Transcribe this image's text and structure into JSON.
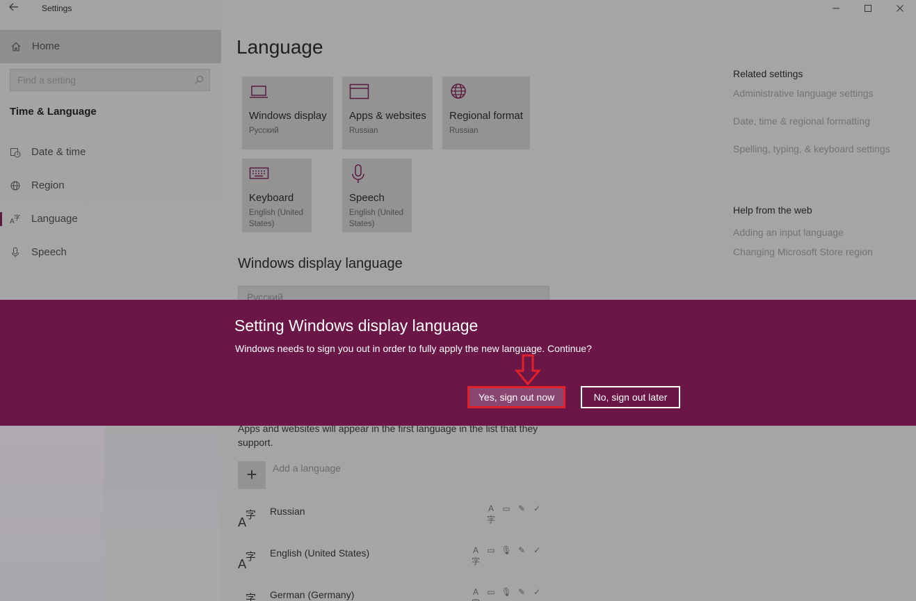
{
  "window": {
    "title": "Settings",
    "back_icon": "back-arrow-icon",
    "controls": [
      "minimize-icon",
      "maximize-icon",
      "close-icon"
    ]
  },
  "sidebar": {
    "home_label": "Home",
    "search_placeholder": "Find a setting",
    "section_title": "Time & Language",
    "items": [
      {
        "label": "Date & time",
        "icon": "calendar-clock-icon"
      },
      {
        "label": "Region",
        "icon": "globe-icon"
      },
      {
        "label": "Language",
        "icon": "language-icon",
        "active": true
      },
      {
        "label": "Speech",
        "icon": "microphone-icon"
      }
    ]
  },
  "main": {
    "title": "Language",
    "tiles": [
      {
        "name": "Windows display",
        "sub": "Русский",
        "icon": "laptop-icon"
      },
      {
        "name": "Apps & websites",
        "sub": "Russian",
        "icon": "browser-window-icon"
      },
      {
        "name": "Regional format",
        "sub": "Russian",
        "icon": "globe-icon"
      },
      {
        "name": "Keyboard",
        "sub": "English (United States)",
        "icon": "keyboard-icon"
      },
      {
        "name": "Speech",
        "sub": "English (United States)",
        "icon": "microphone-icon"
      }
    ],
    "display_language_heading": "Windows display language",
    "display_language_value": "Русский",
    "preferred_text": "Apps and websites will appear in the first language in the list that they support.",
    "add_language_label": "Add a language",
    "languages": [
      {
        "name": "Russian",
        "features": [
          "language-pack-icon",
          "speech-bubble-icon",
          "handwriting-icon",
          "spellcheck-icon"
        ]
      },
      {
        "name": "English (United States)",
        "features": [
          "language-pack-icon",
          "speech-bubble-icon",
          "microphone-icon",
          "handwriting-icon",
          "spellcheck-icon"
        ]
      },
      {
        "name": "German (Germany)",
        "features": [
          "language-pack-icon",
          "speech-bubble-icon",
          "microphone-icon",
          "handwriting-icon",
          "spellcheck-icon"
        ]
      }
    ]
  },
  "related_settings": {
    "heading": "Related settings",
    "links": [
      "Administrative language settings",
      "Date, time & regional formatting",
      "Spelling, typing, & keyboard settings"
    ]
  },
  "help": {
    "heading": "Help from the web",
    "links": [
      "Adding an input language",
      "Changing Microsoft Store region"
    ]
  },
  "dialog": {
    "title": "Setting Windows display language",
    "message": "Windows needs to sign you out in order to fully apply the new language. Continue?",
    "yes_label": "Yes, sign out now",
    "no_label": "No, sign out later",
    "accent_color": "#6a1646",
    "highlight_color": "#e0202a"
  }
}
